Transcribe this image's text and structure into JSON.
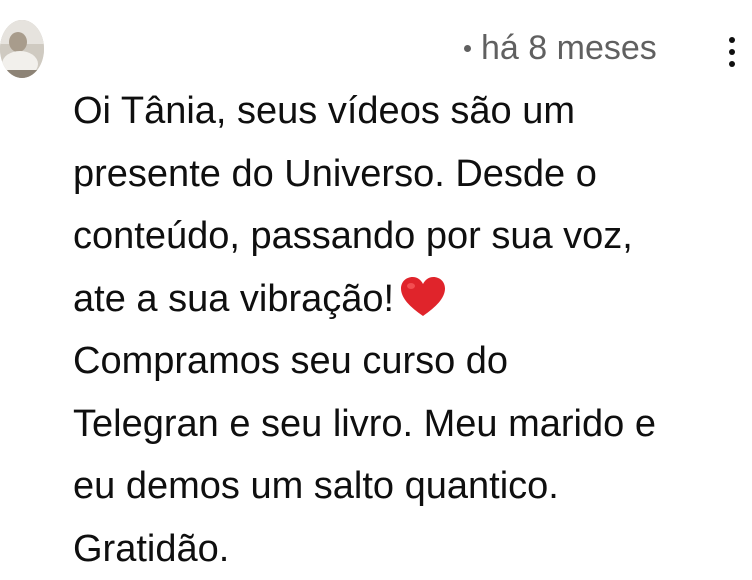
{
  "comment": {
    "time_prefix": "há",
    "timestamp": "há 8 meses",
    "lines": [
      "Oi Tânia, seus vídeos são um",
      "presente do Universo. Desde o",
      "conteúdo, passando por sua voz,",
      "ate a sua vibração!",
      "Compramos seu curso do",
      "Telegran e seu livro. Meu marido e",
      "eu demos um salto quantico.",
      "Gratidão."
    ],
    "emoji": "red-heart",
    "emoji_color": "#e0242b"
  }
}
